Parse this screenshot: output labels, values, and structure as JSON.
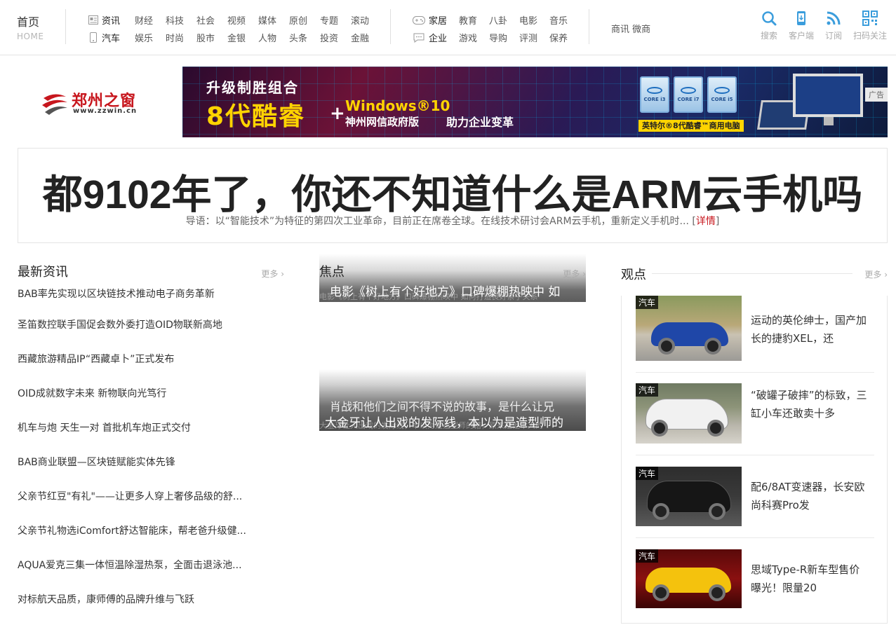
{
  "nav": {
    "home": "首页",
    "home_en": "HOME",
    "group1": [
      [
        "资讯",
        "财经",
        "科技",
        "社会",
        "视频",
        "媒体",
        "原创",
        "专题",
        "滚动"
      ],
      [
        "汽车",
        "娱乐",
        "时尚",
        "股市",
        "金银",
        "人物",
        "头条",
        "投资",
        "金融"
      ]
    ],
    "group2": [
      [
        "家居",
        "教育",
        "八卦",
        "电影",
        "音乐"
      ],
      [
        "企业",
        "游戏",
        "导购",
        "评测",
        "保养"
      ]
    ],
    "text_links": "商讯 微商",
    "tools": [
      "搜索",
      "客户端",
      "订阅",
      "扫码关注"
    ]
  },
  "logo": {
    "name": "郑州之窗",
    "url": "www.zzwin.cn"
  },
  "banner": {
    "line1": "升级制胜组合",
    "line2": "8代酷睿",
    "plus": "+",
    "windows": "Windows®10",
    "sub": "神州网信政府版",
    "slogan": "助力企业变革",
    "chips": [
      "CORE i3",
      "CORE i7",
      "CORE i5"
    ],
    "tagline": "英特尔®8代酷睿™商用电脑",
    "ad_label": "广告"
  },
  "headline": {
    "title": "都9102年了，你还不知道什么是ARM云手机吗",
    "lead": "导语：以“智能技术”为特征的第四次工业革命，目前正在席卷全球。在线技术研讨会ARM云手机，重新定义手机时...",
    "lead_open": "[",
    "lead_more": "详情",
    "lead_close": "]"
  },
  "latest": {
    "title": "最新资讯",
    "more": "更多",
    "items": [
      "BAB率先实现以区块链技术推动电子商务革新",
      "圣笛数控联手国促会数外委打造OID物联新高地",
      "西藏旅游精品IP“西藏卓卜”正式发布",
      "OID成就数字未来 新物联向光笃行",
      "机车与炮 天生一对 首批机车炮正式交付",
      "BAB商业联盟—区块链赋能实体先锋",
      "父亲节红豆\"有礼\"——让更多人穿上奢侈品级的舒...",
      "父亲节礼物选iComfort舒达智能床，帮老爸升级健...",
      "AQUA爱克三集一体恒温除湿热泵，全面击退泳池...",
      "对标航天品质，康师傅的品牌升维与飞跃"
    ]
  },
  "focus": {
    "title": "焦点",
    "more": "更多",
    "card1": {
      "title": "电影《树上有个好地方》口碑爆棚热映中 如",
      "ghost": "电影《树上有个好地方》口碑爆棚热映中 如何打造良好亲子关系"
    },
    "card2": {
      "title1": "肖战和他们之间不得不说的故事，是什么让兄",
      "title2": "大金牙让人出戏的发际线，本以为是造型师的",
      "ghost": "大金牙让人出戏的发际线，本以为是造型师的错，原来是他本人的"
    }
  },
  "opinion": {
    "title": "观点",
    "more": "更多",
    "items": [
      {
        "tag": "汽车",
        "text": "运动的英伦绅士，国产加长的捷豹XEL，还"
      },
      {
        "tag": "汽车",
        "text": "“破罐子破摔”的标致，三缸小车还敢卖十多"
      },
      {
        "tag": "汽车",
        "text": "配6/8AT变速器，长安欧尚科赛Pro发"
      },
      {
        "tag": "汽车",
        "text": "思域Type-R新车型售价曝光！限量20"
      }
    ]
  },
  "colors": {
    "brand_red": "#c7161d",
    "accent_blue": "#3b9ddc"
  }
}
